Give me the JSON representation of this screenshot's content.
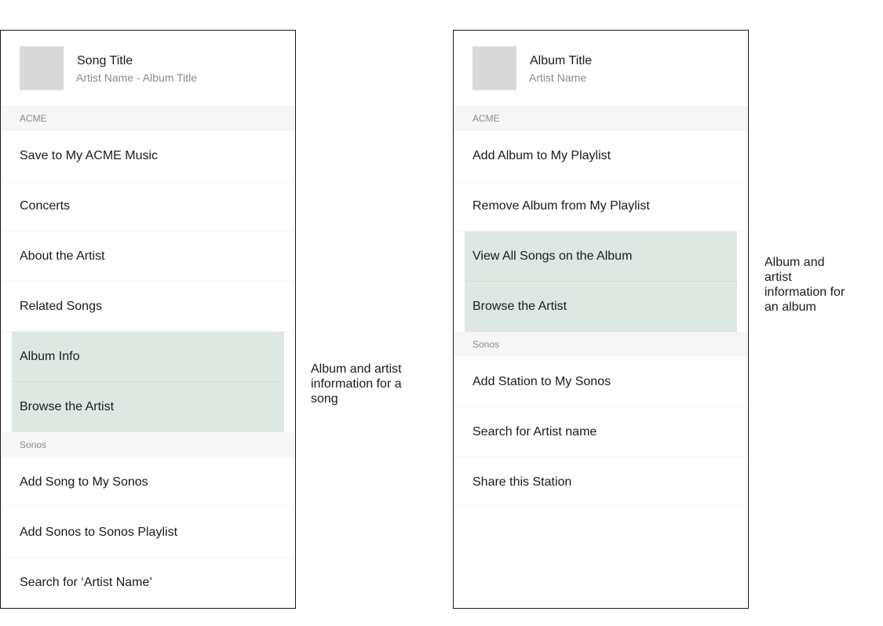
{
  "song_panel": {
    "title": "Song Title",
    "subtitle": "Artist Name - Album Title",
    "acme_section": "ACME",
    "acme_items": [
      "Save to My ACME Music",
      "Concerts",
      "About the Artist",
      "Related Songs",
      "Album Info",
      "Browse the Artist"
    ],
    "sonos_section": "Sonos",
    "sonos_items": [
      "Add Song to My Sonos",
      "Add Sonos to Sonos Playlist",
      "Search for ‘Artist Name’"
    ],
    "note": "Album and artist information for a song"
  },
  "album_panel": {
    "title": "Album Title",
    "subtitle": "Artist Name",
    "acme_section": "ACME",
    "acme_items": [
      "Add Album to My Playlist",
      "Remove Album from My Playlist",
      "View All Songs on the Album",
      "Browse the Artist"
    ],
    "sonos_section": "Sonos",
    "sonos_items": [
      "Add Station to My Sonos",
      "Search for Artist name",
      "Share this Station"
    ],
    "note": "Album and artist information for an album"
  },
  "colors": {
    "highlight": "#dfe7e3",
    "section_bg": "#f6f6f6",
    "thumb": "#d9d9d9"
  }
}
